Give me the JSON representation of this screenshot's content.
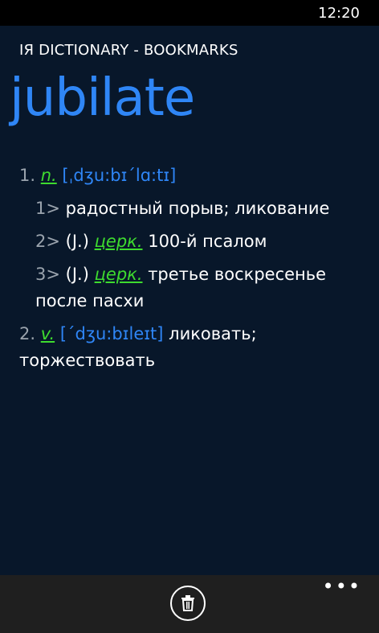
{
  "status_bar": {
    "time": "12:20"
  },
  "app": {
    "title": "IЯ DICTIONARY - BOOKMARKS"
  },
  "headword": "jubilate",
  "entries": [
    {
      "number": "1.",
      "pos": "n.",
      "transcription": "[ˌdʒu:bɪˊlɑ:tɪ]"
    },
    {
      "number": "1>",
      "text": "радостный порыв; ликование"
    },
    {
      "number": "2>",
      "paren": "(J.)",
      "label": "церк.",
      "text": "100-й псалом"
    },
    {
      "number": "3>",
      "paren": "(J.)",
      "label": "церк.",
      "text": "третье воскресенье после пасхи"
    },
    {
      "number": "2.",
      "pos": "v.",
      "transcription": "[ˊdʒu:bɪleɪt]",
      "text": "ликовать; торжествовать"
    }
  ],
  "app_bar": {
    "buttons": [
      {
        "icon": "trash-icon"
      }
    ],
    "more_label": "•••"
  },
  "colors": {
    "accent": "#2f86f6",
    "label_green": "#3edb2f",
    "background": "#08172a"
  }
}
